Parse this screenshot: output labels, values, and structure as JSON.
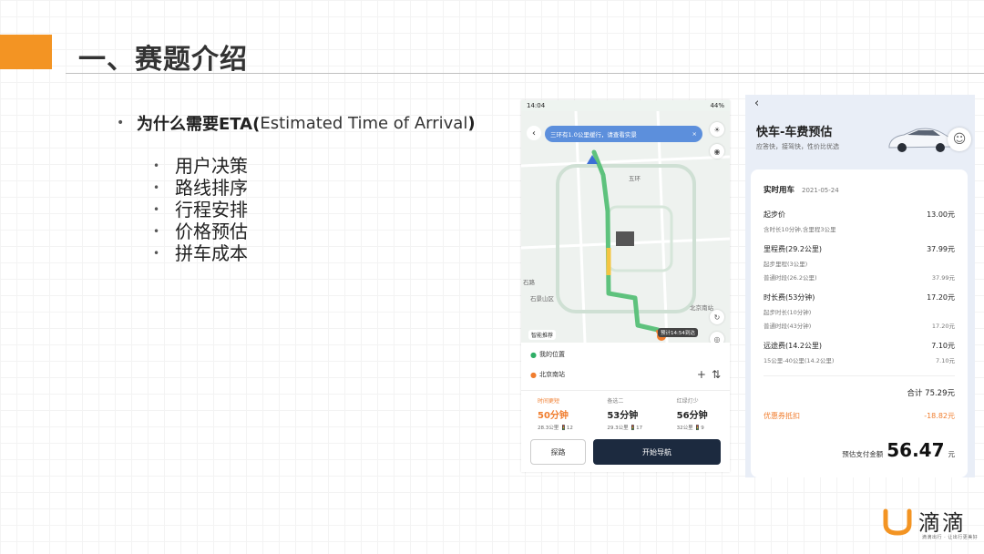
{
  "slide": {
    "title": "一、赛题介绍",
    "bullet": {
      "strong": "为什么需要ETA(",
      "light": "Estimated Time of Arrival",
      "close": ")"
    },
    "sub_items": [
      "用户决策",
      "路线排序",
      "行程安排",
      "价格预估",
      "拼车成本"
    ]
  },
  "phone": {
    "status_time": "14:04",
    "status_right": "44%",
    "back_icon": "chevron-left-icon",
    "notice": {
      "text": "三环有1.0公里缓行，请查看实景",
      "close": "×"
    },
    "map_labels": [
      "五环",
      "石路",
      "石景山区",
      "北京南站"
    ],
    "smart_tag": "智能推荐",
    "eta_badge": "预计14:54到达",
    "origin": "我的位置",
    "destination": "北京南站",
    "add_icon": "+",
    "swap_icon": "⇅",
    "routes": [
      {
        "tag": "时间更短",
        "time": "50分钟",
        "meta": "28.3公里 🚦12",
        "active": true
      },
      {
        "tag": "备选二",
        "time": "53分钟",
        "meta": "29.3公里 🚦17",
        "active": false
      },
      {
        "tag": "红绿灯少",
        "time": "56分钟",
        "meta": "32公里 🚦9",
        "active": false
      }
    ],
    "explore_label": "探路",
    "navigate_label": "开始导航"
  },
  "fare": {
    "back_icon": "chevron-left-icon",
    "title": "快车-车费预估",
    "subtitle": "应答快，接驾快，性价比优选",
    "card_head": "实时用车",
    "date": "2021-05-24",
    "fees": [
      {
        "name": "起步价",
        "value": "13.00元",
        "subs": [
          {
            "label": "含时长10分钟,含里程3公里",
            "value": ""
          }
        ]
      },
      {
        "name": "里程费(29.2公里)",
        "value": "37.99元",
        "subs": [
          {
            "label": "起步里程(3公里)",
            "value": ""
          },
          {
            "label": "普通时段(26.2公里)",
            "value": "37.99元"
          }
        ]
      },
      {
        "name": "时长费(53分钟)",
        "value": "17.20元",
        "subs": [
          {
            "label": "起步时长(10分钟)",
            "value": ""
          },
          {
            "label": "普通时段(43分钟)",
            "value": "17.20元"
          }
        ]
      },
      {
        "name": "远途费(14.2公里)",
        "value": "7.10元",
        "subs": [
          {
            "label": "15公里-40公里(14.2公里)",
            "value": "7.10元"
          }
        ]
      }
    ],
    "total": "合计 75.29元",
    "coupon_label": "优惠券抵扣",
    "coupon_value": "-18.82元",
    "pay_label": "预估支付金额",
    "pay_amount": "56.47",
    "pay_unit": "元"
  },
  "logo": {
    "word": "滴滴",
    "sub": "滴滴出行 · 让出行更美好"
  },
  "colors": {
    "accent": "#f39423",
    "nav_button": "#1c2a3f",
    "highlight": "#f07d2e",
    "route": "#5ec27d"
  }
}
